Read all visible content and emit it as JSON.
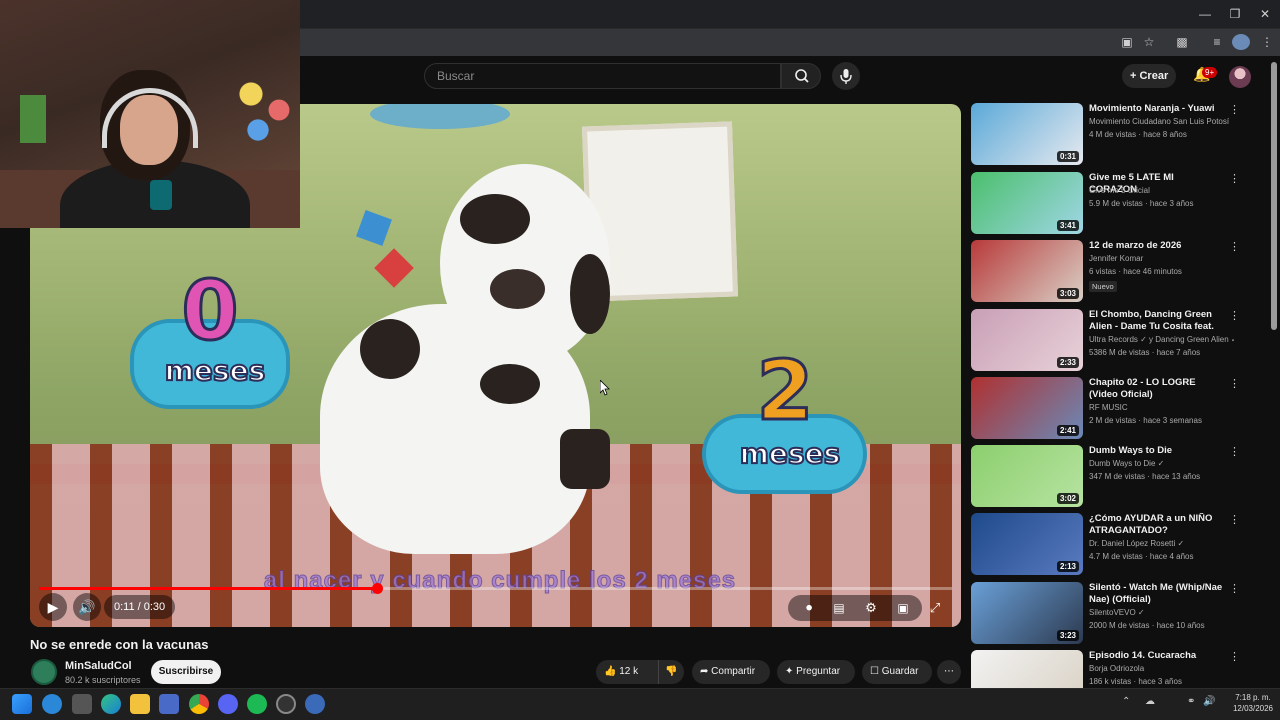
{
  "search": {
    "placeholder": "Buscar"
  },
  "header": {
    "create_label": "Crear",
    "notif_count": "9+"
  },
  "player": {
    "current_time": "0:11",
    "duration": "0:30",
    "time_display": "0:11 / 0:30",
    "progress_fraction": 0.37,
    "subtitle_text": "al nacer y cuando cumple los 2 meses",
    "overlay_left": {
      "number": "0",
      "label": "meses"
    },
    "overlay_right": {
      "number": "2",
      "label": "meses"
    }
  },
  "video_info": {
    "title": "No se enrede con la vacunas",
    "channel_name": "MinSaludCol",
    "subscribers": "80.2 k suscriptores",
    "subscribe_label": "Suscribirse",
    "likes": "12 k",
    "share_label": "Compartir",
    "ask_label": "Preguntar",
    "save_label": "Guardar"
  },
  "recommendations": [
    {
      "title": "Movimiento Naranja - Yuawi",
      "channel": "Movimiento Ciudadano San Luis Potosí",
      "stats": "4 M de vistas · hace 8 años",
      "duration": "0:31",
      "badge": "",
      "thumb_colors": [
        "#5aa9d8",
        "#e6e9ef"
      ]
    },
    {
      "title": "Give me 5   LATE MI CORAZON",
      "channel": "Give me 5 Oficial",
      "stats": "5.9 M de vistas · hace 3 años",
      "duration": "3:41",
      "badge": "",
      "thumb_colors": [
        "#4bbf6c",
        "#9fd6e6"
      ]
    },
    {
      "title": "12 de marzo de 2026",
      "channel": "Jennifer Komar",
      "stats": "6 vistas · hace 46 minutos",
      "duration": "3:03",
      "badge": "Nuevo",
      "thumb_colors": [
        "#b83a3a",
        "#d9d0c6"
      ]
    },
    {
      "title": "El Chombo, Dancing Green Alien - Dame Tu Cosita feat. Cutty ...",
      "channel": "Ultra Records ✓ y Dancing Green Alien ✓",
      "stats": "5386 M de vistas · hace 7 años",
      "duration": "2:33",
      "badge": "",
      "thumb_colors": [
        "#c99fb6",
        "#e8d2d8"
      ]
    },
    {
      "title": "Chapito 02 - LO LOGRE (Video Oficial)",
      "channel": "RF MUSIC",
      "stats": "2 M de vistas · hace 3 semanas",
      "duration": "2:41",
      "badge": "",
      "thumb_colors": [
        "#b03030",
        "#6a8ab8"
      ]
    },
    {
      "title": "Dumb Ways to Die",
      "channel": "Dumb Ways to Die ✓",
      "stats": "347 M de vistas · hace 13 años",
      "duration": "3:02",
      "badge": "",
      "thumb_colors": [
        "#8ccf6e",
        "#b7e3a1"
      ]
    },
    {
      "title": "¿Cómo AYUDAR a un NIÑO ATRAGANTADO?",
      "channel": "Dr. Daniel López Rosetti ✓",
      "stats": "4.7 M de vistas · hace 4 años",
      "duration": "2:13",
      "badge": "",
      "thumb_colors": [
        "#1e4a8a",
        "#5a7ac0"
      ]
    },
    {
      "title": "Silentó - Watch Me (Whip/Nae Nae) (Official)",
      "channel": "SilentoVEVO ✓",
      "stats": "2000 M de vistas · hace 10 años",
      "duration": "3:23",
      "badge": "",
      "thumb_colors": [
        "#6aa0d8",
        "#2d3a50"
      ]
    },
    {
      "title": "Episodio 14. Cucaracha",
      "channel": "Borja Odriozola",
      "stats": "186 k vistas · hace 3 años",
      "duration": "",
      "badge": "",
      "thumb_colors": [
        "#f2f2f2",
        "#d8d0c2"
      ]
    }
  ],
  "taskbar": {
    "time": "7:18 p. m.",
    "date": "12/03/2026"
  },
  "colors": {
    "accent": "#ff0000",
    "background": "#0f0f0f",
    "surface": "#272727"
  }
}
